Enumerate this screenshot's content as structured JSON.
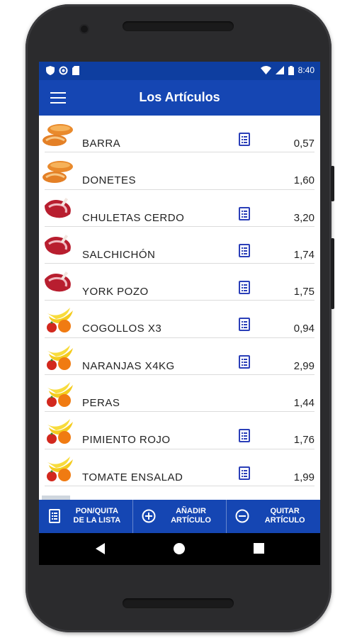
{
  "status_bar": {
    "left_icons": [
      "shield-icon",
      "sync-icon",
      "sdcard-icon"
    ],
    "right_icons": [
      "wifi-icon",
      "signal-icon",
      "battery-icon"
    ],
    "time": "8:40"
  },
  "toolbar": {
    "menu_icon": "hamburger-menu-icon",
    "title": "Los Artículos"
  },
  "items": [
    {
      "name": "BARRA",
      "price": "0,57",
      "category": "bread",
      "in_list": true
    },
    {
      "name": "DONETES",
      "price": "1,60",
      "category": "bread",
      "in_list": false
    },
    {
      "name": "CHULETAS CERDO",
      "price": "3,20",
      "category": "meat",
      "in_list": true
    },
    {
      "name": "SALCHICHÓN",
      "price": "1,74",
      "category": "meat",
      "in_list": true
    },
    {
      "name": "YORK POZO",
      "price": "1,75",
      "category": "meat",
      "in_list": true
    },
    {
      "name": "COGOLLOS X3",
      "price": "0,94",
      "category": "fruit",
      "in_list": true
    },
    {
      "name": "NARANJAS X4KG",
      "price": "2,99",
      "category": "fruit",
      "in_list": true
    },
    {
      "name": "PERAS",
      "price": "1,44",
      "category": "fruit",
      "in_list": false
    },
    {
      "name": "PIMIENTO ROJO",
      "price": "1,76",
      "category": "fruit",
      "in_list": true
    },
    {
      "name": "TOMATE ENSALAD",
      "price": "1,99",
      "category": "fruit",
      "in_list": true
    }
  ],
  "bottom_bar": {
    "toggle_list": {
      "label": "PON/QUITA\nDE LA LISTA",
      "icon": "list-icon"
    },
    "add_item": {
      "label": "AÑADIR\nARTÍCULO",
      "icon": "add-circle-icon"
    },
    "remove_item": {
      "label": "QUITAR\nARTÍCULO",
      "icon": "remove-circle-icon"
    }
  },
  "nav_bar": {
    "back": "back-icon",
    "home": "home-icon",
    "recents": "recents-icon"
  },
  "colors": {
    "status_bar": "#0e3ea0",
    "primary": "#1546b3",
    "list_icon": "#2b3fb8",
    "text": "#222222"
  }
}
